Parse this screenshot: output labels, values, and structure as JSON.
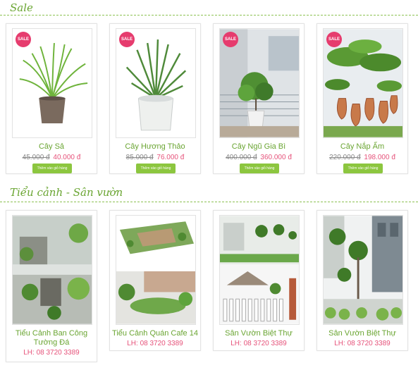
{
  "sections": {
    "sale": {
      "title": "Sale"
    },
    "landscape": {
      "title": "Tiểu cảnh - Sân vườn"
    }
  },
  "sale_products": [
    {
      "name": "Cây Sả",
      "old_price": "45.000 đ",
      "new_price": "40.000 đ",
      "badge": "SALE",
      "button": "Thêm vào giỏ hàng",
      "image_icon": "lemongrass-plant-image"
    },
    {
      "name": "Cây Hương Thảo",
      "old_price": "85.000 đ",
      "new_price": "76.000 đ",
      "badge": "SALE",
      "button": "Thêm vào giỏ hàng",
      "image_icon": "rosemary-plant-image"
    },
    {
      "name": "Cây Ngũ Gia Bì",
      "old_price": "400.000 đ",
      "new_price": "360.000 đ",
      "badge": "SALE",
      "button": "Thêm vào giỏ hàng",
      "image_icon": "schefflera-plant-image"
    },
    {
      "name": "Cây Nắp Ấm",
      "old_price": "220.000 đ",
      "new_price": "198.000 đ",
      "badge": "SALE",
      "button": "Thêm vào giỏ hàng",
      "image_icon": "pitcher-plant-image"
    }
  ],
  "landscape_products": [
    {
      "name": "Tiểu Cảnh Ban Công Tường Đá",
      "contact": "LH: 08 3720 3389",
      "image_icon": "balcony-garden-image"
    },
    {
      "name": "Tiểu Cảnh Quán Cafe 14",
      "contact": "LH: 08 3720 3389",
      "image_icon": "cafe-garden-image"
    },
    {
      "name": "Sân Vườn Biệt Thự",
      "contact": "LH: 08 3720 3389",
      "image_icon": "villa-garden-image"
    },
    {
      "name": "Sân Vườn Biệt Thự",
      "contact": "LH: 08 3720 3389",
      "image_icon": "villa-garden-image"
    }
  ],
  "colors": {
    "accent_green": "#6aa532",
    "price_pink": "#e6527a",
    "button_green": "#8cc63f",
    "badge_pink": "#e63c6e"
  }
}
